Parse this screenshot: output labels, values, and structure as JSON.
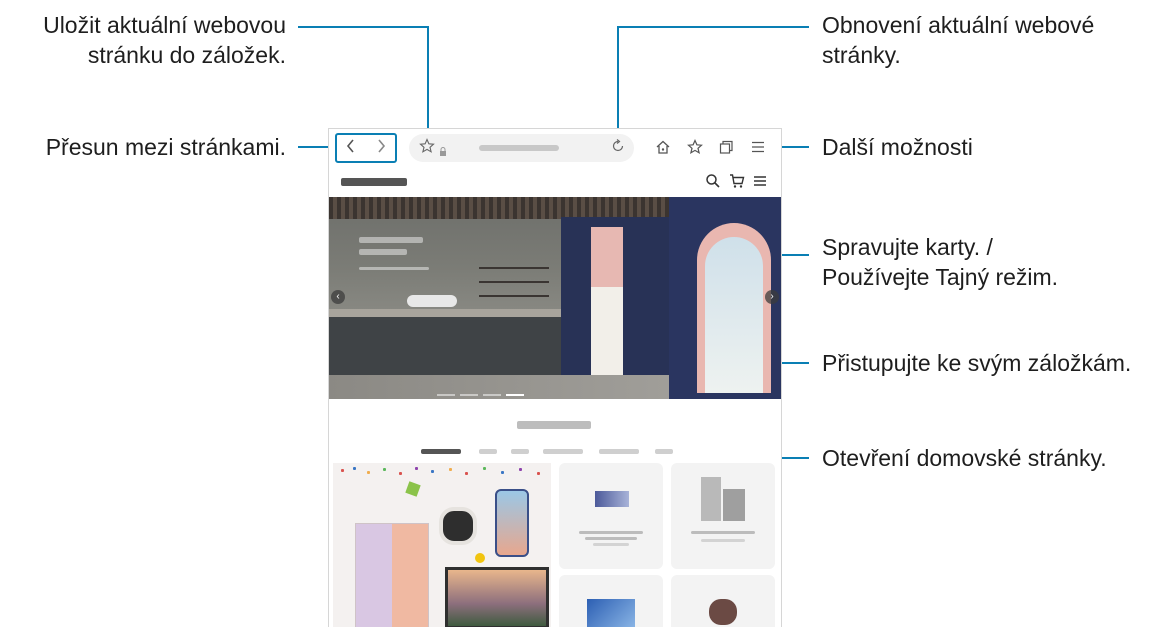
{
  "callouts": {
    "bookmark_save": {
      "line1": "Uložit aktuální webovou",
      "line2": "stránku do záložek."
    },
    "navigate": "Přesun mezi stránkami.",
    "refresh": {
      "line1": "Obnovení aktuální webové",
      "line2": "stránky."
    },
    "more_options": "Další možnosti",
    "tabs": {
      "line1": "Spravujte karty. /",
      "line2": "Používejte Tajný režim."
    },
    "bookmarks": "Přistupujte ke svým záložkám.",
    "home": "Otevření domovské stránky."
  },
  "browser": {
    "toolbar": {
      "back_icon": "chevron-left-icon",
      "forward_icon": "chevron-right-icon",
      "bookmark_icon": "star-outline-icon",
      "lock_icon": "lock-icon",
      "refresh_icon": "refresh-icon",
      "home_icon": "home-icon",
      "bookmarks_icon": "star-list-icon",
      "tabs_icon": "tabs-icon",
      "menu_icon": "hamburger-icon"
    },
    "site_bar": {
      "search_icon": "search-icon",
      "cart_icon": "cart-icon",
      "menu_icon": "hamburger-icon"
    }
  },
  "colors": {
    "accent": "#0a7fb4",
    "text": "#1e1e1e"
  }
}
